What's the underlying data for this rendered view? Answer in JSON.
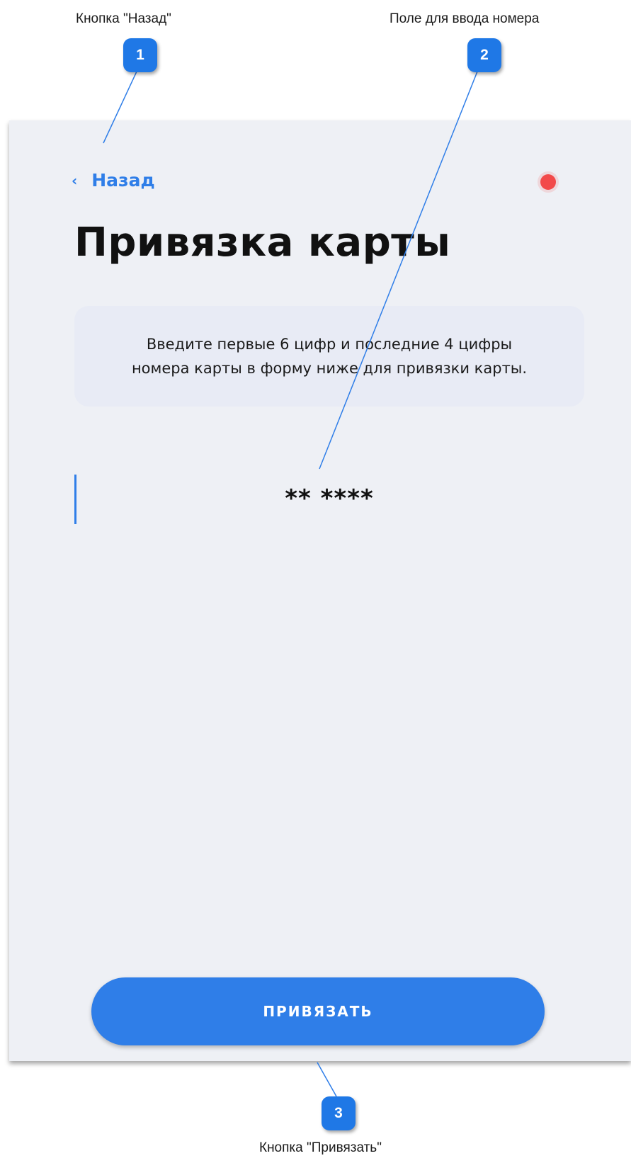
{
  "annotations": [
    {
      "number": "1",
      "label": "Кнопка \"Назад\""
    },
    {
      "number": "2",
      "label": "Поле для ввода номера"
    },
    {
      "number": "3",
      "label": "Кнопка \"Привязать\""
    }
  ],
  "screen": {
    "back_label": "Назад",
    "back_icon": "chevron-left-icon",
    "title": "Привязка карты",
    "info_text": "Введите первые 6 цифр и последние 4 цифры номера карты в форму ниже для привязки карты.",
    "card_mask": "** ****",
    "submit_label": "ПРИВЯЗАТЬ",
    "accent_color": "#2f7ee8",
    "status_dot_color": "#f24a4a"
  }
}
